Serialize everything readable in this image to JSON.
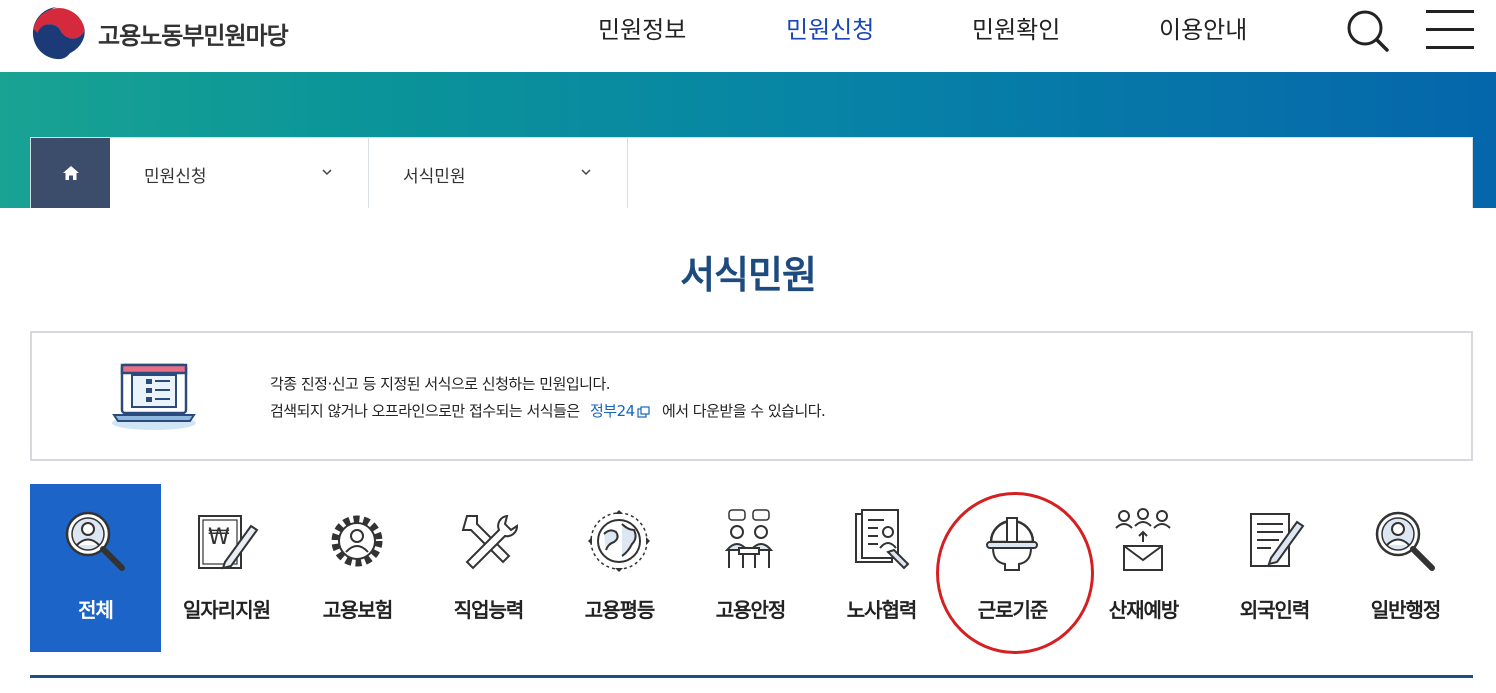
{
  "header": {
    "logo_text": "고용노동부민원마당",
    "nav": [
      {
        "label": "민원정보",
        "active": false
      },
      {
        "label": "민원신청",
        "active": true
      },
      {
        "label": "민원확인",
        "active": false
      },
      {
        "label": "이용안내",
        "active": false
      }
    ],
    "icons": [
      "search-icon",
      "hamburger-menu-icon"
    ]
  },
  "breadcrumb": {
    "home_icon": "home-icon",
    "items": [
      {
        "label": "민원신청"
      },
      {
        "label": "서식민원"
      }
    ]
  },
  "page": {
    "title": "서식민원"
  },
  "info": {
    "line1": "각종 진정·신고 등 지정된 서식으로 신청하는 민원입니다.",
    "line2_prefix": "검색되지 않거나 오프라인으로만 접수되는 서식들은",
    "link_text": "정부24",
    "line2_suffix": "에서 다운받을 수 있습니다."
  },
  "categories": [
    {
      "label": "전체",
      "icon": "magnifier-person-icon",
      "active": true
    },
    {
      "label": "일자리지원",
      "icon": "won-document-pen-icon",
      "active": false
    },
    {
      "label": "고용보험",
      "icon": "gear-person-icon",
      "active": false
    },
    {
      "label": "직업능력",
      "icon": "tools-icon",
      "active": false
    },
    {
      "label": "고용평등",
      "icon": "globe-icon",
      "active": false
    },
    {
      "label": "고용안정",
      "icon": "meeting-icon",
      "active": false
    },
    {
      "label": "노사협력",
      "icon": "document-person-icon",
      "active": false
    },
    {
      "label": "근로기준",
      "icon": "hard-hat-icon",
      "active": false
    },
    {
      "label": "산재예방",
      "icon": "people-envelope-icon",
      "active": false
    },
    {
      "label": "외국인력",
      "icon": "document-pencil-icon",
      "active": false
    },
    {
      "label": "일반행정",
      "icon": "magnifier-person-icon",
      "active": false
    }
  ],
  "colors": {
    "accent": "#1c64c8",
    "nav_active": "#1a47b8",
    "title": "#1d4a7f",
    "home_bg": "#3c4d6b",
    "link": "#1565c0",
    "highlight": "#d42020"
  }
}
